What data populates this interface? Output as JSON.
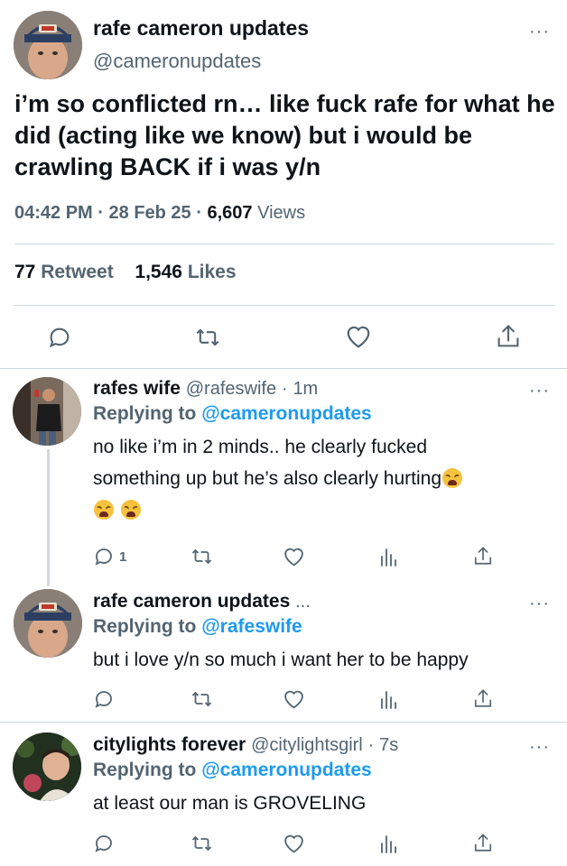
{
  "main_tweet": {
    "name": "rafe cameron updates",
    "handle": "@cameronupdates",
    "text": "i’m so conflicted rn… like fuck rafe for what he did (acting like we know) but i would be crawling BACK if i was y/n",
    "time": "04:42 PM",
    "sep1": "·",
    "date": "28 Feb 25",
    "sep2": "·",
    "views_count": "6,607",
    "views_label": "Views",
    "retweets_count": "77",
    "retweets_label": "Retweet",
    "likes_count": "1,546",
    "likes_label": "Likes",
    "more": "···"
  },
  "replies": [
    {
      "name": "rafes wife",
      "handle": "@rafeswife",
      "sep": "·",
      "time": "1m",
      "replying_prefix": "Replying to",
      "replying_to": "@cameronupdates",
      "text_line1": "no like i’m in 2 minds.. he clearly fucked",
      "text_line2": "something up but he’s also clearly hurting",
      "reply_count": "1",
      "more": "···"
    },
    {
      "name": "rafe cameron updates",
      "ellipsis": "...",
      "replying_prefix": "Replying to",
      "replying_to": "@rafeswife",
      "text_line1": "but i love y/n so much i want her to be happy",
      "more": "···"
    },
    {
      "name": "citylights forever",
      "handle": "@citylightsgirl",
      "sep": "·",
      "time": "7s",
      "replying_prefix": "Replying to",
      "replying_to": "@cameronupdates",
      "text_line1": "at least our man is GROVELING",
      "more": "···"
    }
  ],
  "icons": {
    "reply": "reply-icon",
    "retweet": "retweet-icon",
    "like": "heart-icon",
    "views": "analytics-icon",
    "share": "share-icon"
  },
  "colors": {
    "accent": "#1d9bf0",
    "text": "#0f1419",
    "secondary": "#536471",
    "divider": "#cfd9de"
  }
}
